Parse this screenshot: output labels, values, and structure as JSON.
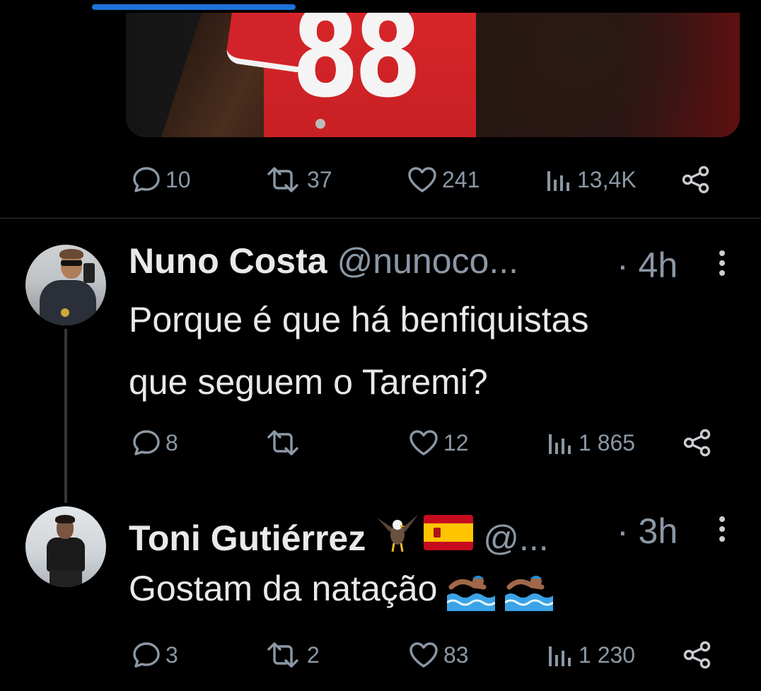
{
  "media": {
    "jersey_number": "88"
  },
  "post_top": {
    "replies": "10",
    "reposts": "37",
    "likes": "241",
    "views": "13,4K"
  },
  "reply_1": {
    "display_name": "Nuno Costa",
    "handle": "@nunoco...",
    "time": "· 4h",
    "text_line1": "Porque é que há benfiquistas",
    "text_line2": "que seguem o Taremi?",
    "replies": "8",
    "reposts": "",
    "likes": "12",
    "views": "1 865"
  },
  "reply_2": {
    "display_name": "Toni Gutiérrez",
    "handle": "@...",
    "time": "· 3h",
    "text": "Gostam da natação",
    "emojis": [
      "eagle-icon",
      "spain-flag-icon",
      "swimmer-icon",
      "swimmer-icon"
    ],
    "replies": "3",
    "reposts": "2",
    "likes": "83",
    "views": "1 230"
  },
  "colors": {
    "background": "#000000",
    "text": "#e7e9ea",
    "secondary_text": "#8b98a5",
    "progress": "#1d73d8",
    "divider": "#2f3336"
  }
}
